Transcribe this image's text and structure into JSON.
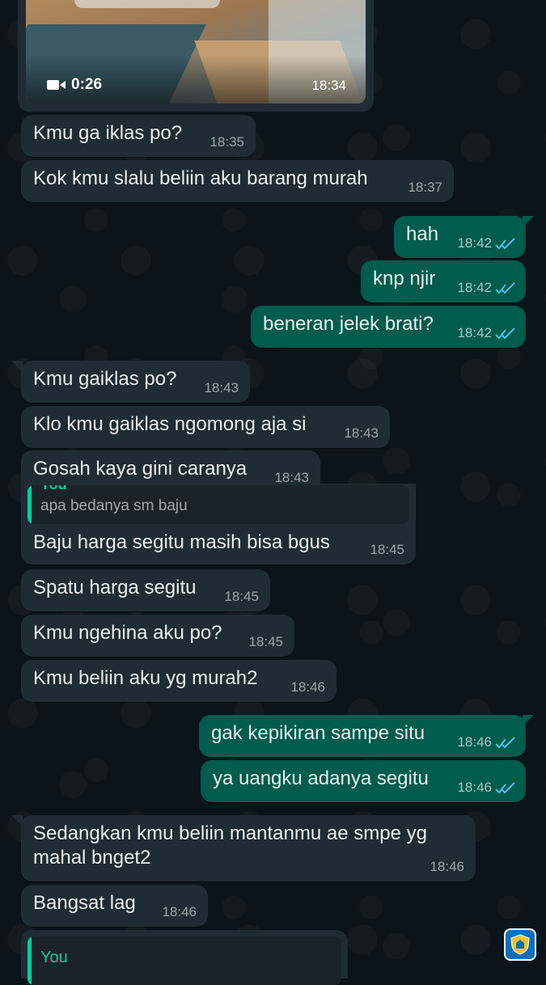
{
  "video": {
    "duration": "0:26",
    "time": "18:34"
  },
  "messages": [
    {
      "text": "Kmu ga iklas po?",
      "time": "18:35"
    },
    {
      "text": "Kok kmu slalu beliin aku barang murah",
      "time": "18:37"
    },
    {
      "text": "hah",
      "time": "18:42"
    },
    {
      "text": "knp njir",
      "time": "18:42"
    },
    {
      "text": "beneran jelek brati?",
      "time": "18:42"
    },
    {
      "text": "Kmu gaiklas po?",
      "time": "18:43"
    },
    {
      "text": "Klo kmu gaiklas ngomong aja si",
      "time": "18:43"
    },
    {
      "text": "Gosah kaya gini caranya",
      "time": "18:43"
    },
    {
      "text": "Baju harga segitu masih bisa bgus",
      "time": "18:45",
      "quote_sender": "You",
      "quote_text": "apa bedanya sm baju"
    },
    {
      "text": "Spatu harga segitu",
      "time": "18:45"
    },
    {
      "text": "Kmu ngehina aku po?",
      "time": "18:45"
    },
    {
      "text": "Kmu beliin aku yg murah2",
      "time": "18:46"
    },
    {
      "text": "gak kepikiran sampe situ",
      "time": "18:46"
    },
    {
      "text": "ya uangku adanya segitu",
      "time": "18:46"
    },
    {
      "text_line1": "Sedangkan kmu beliin mantanmu ae smpe yg",
      "text_line2": "mahal bnget2",
      "time": "18:46"
    },
    {
      "text": "Bangsat lag",
      "time": "18:46"
    }
  ],
  "bottom_quote": {
    "sender": "You"
  },
  "colors": {
    "background": "#0b141a",
    "incoming_bubble": "#202c33",
    "outgoing_bubble": "#005c4b",
    "read_ticks": "#53bdeb",
    "quote_accent": "#06cf9c"
  },
  "icons": [
    "video-camera-icon",
    "double-check-icon",
    "city-logo-icon"
  ]
}
